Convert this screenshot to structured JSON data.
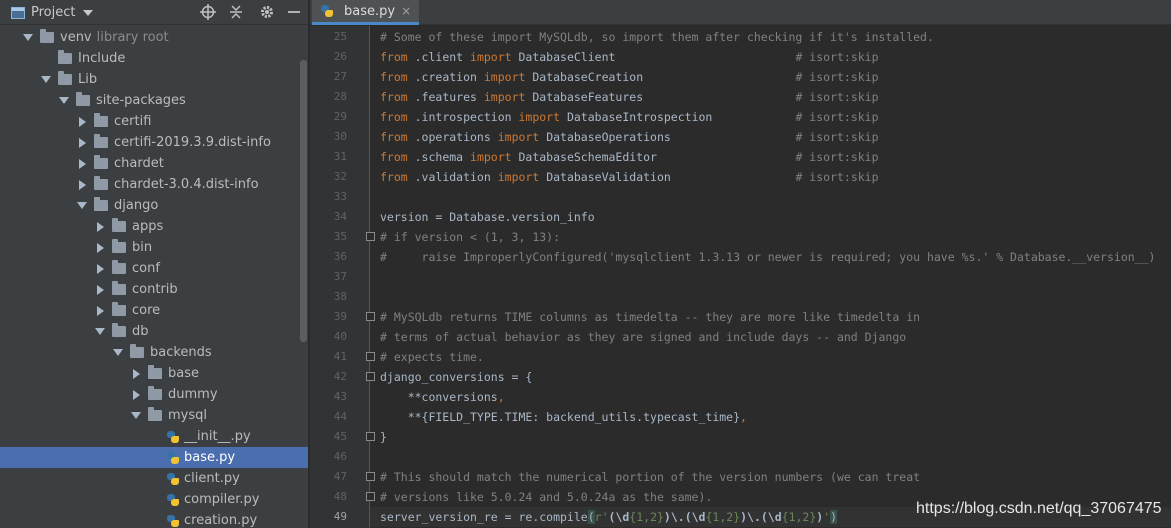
{
  "project_panel": {
    "title": "Project",
    "tree": [
      {
        "label": "venv",
        "sub": "library root",
        "indent": 0,
        "expand": "down",
        "icon": "folder-icon"
      },
      {
        "label": "Include",
        "indent": 1,
        "expand": "none",
        "icon": "folder-icon"
      },
      {
        "label": "Lib",
        "indent": 1,
        "expand": "down",
        "icon": "folder-icon"
      },
      {
        "label": "site-packages",
        "indent": 2,
        "expand": "down",
        "icon": "folder-icon"
      },
      {
        "label": "certifi",
        "indent": 3,
        "expand": "right",
        "icon": "folder-icon"
      },
      {
        "label": "certifi-2019.3.9.dist-info",
        "indent": 3,
        "expand": "right",
        "icon": "folder-icon"
      },
      {
        "label": "chardet",
        "indent": 3,
        "expand": "right",
        "icon": "folder-icon"
      },
      {
        "label": "chardet-3.0.4.dist-info",
        "indent": 3,
        "expand": "right",
        "icon": "folder-icon"
      },
      {
        "label": "django",
        "indent": 3,
        "expand": "down",
        "icon": "folder-icon"
      },
      {
        "label": "apps",
        "indent": 4,
        "expand": "right",
        "icon": "folder-icon"
      },
      {
        "label": "bin",
        "indent": 4,
        "expand": "right",
        "icon": "folder-icon"
      },
      {
        "label": "conf",
        "indent": 4,
        "expand": "right",
        "icon": "folder-icon"
      },
      {
        "label": "contrib",
        "indent": 4,
        "expand": "right",
        "icon": "folder-icon"
      },
      {
        "label": "core",
        "indent": 4,
        "expand": "right",
        "icon": "folder-icon"
      },
      {
        "label": "db",
        "indent": 4,
        "expand": "down",
        "icon": "folder-icon"
      },
      {
        "label": "backends",
        "indent": 5,
        "expand": "down",
        "icon": "folder-icon"
      },
      {
        "label": "base",
        "indent": 6,
        "expand": "right",
        "icon": "folder-icon"
      },
      {
        "label": "dummy",
        "indent": 6,
        "expand": "right",
        "icon": "folder-icon"
      },
      {
        "label": "mysql",
        "indent": 6,
        "expand": "down",
        "icon": "folder-icon"
      },
      {
        "label": "__init__.py",
        "indent": 7,
        "expand": "none",
        "icon": "python-file-icon"
      },
      {
        "label": "base.py",
        "indent": 7,
        "expand": "none",
        "icon": "python-file-icon",
        "selected": true
      },
      {
        "label": "client.py",
        "indent": 7,
        "expand": "none",
        "icon": "python-file-icon"
      },
      {
        "label": "compiler.py",
        "indent": 7,
        "expand": "none",
        "icon": "python-file-icon"
      },
      {
        "label": "creation.py",
        "indent": 7,
        "expand": "none",
        "icon": "python-file-icon"
      }
    ]
  },
  "editor": {
    "tab_label": "base.py",
    "tab_close": "×",
    "current_line": 49,
    "lines": [
      {
        "n": 25,
        "tokens": [
          [
            "com",
            "# Some of these import MySQLdb, so import them after checking if it's installed."
          ]
        ]
      },
      {
        "n": 26,
        "tokens": [
          [
            "kw",
            "from "
          ],
          [
            "plain",
            ".client "
          ],
          [
            "kw",
            "import "
          ],
          [
            "plain",
            "DatabaseClient                          "
          ],
          [
            "com",
            "# isort:skip"
          ]
        ]
      },
      {
        "n": 27,
        "tokens": [
          [
            "kw",
            "from "
          ],
          [
            "plain",
            ".creation "
          ],
          [
            "kw",
            "import "
          ],
          [
            "plain",
            "DatabaseCreation                      "
          ],
          [
            "com",
            "# isort:skip"
          ]
        ]
      },
      {
        "n": 28,
        "tokens": [
          [
            "kw",
            "from "
          ],
          [
            "plain",
            ".features "
          ],
          [
            "kw",
            "import "
          ],
          [
            "plain",
            "DatabaseFeatures                      "
          ],
          [
            "com",
            "# isort:skip"
          ]
        ]
      },
      {
        "n": 29,
        "tokens": [
          [
            "kw",
            "from "
          ],
          [
            "plain",
            ".introspection "
          ],
          [
            "kw",
            "import "
          ],
          [
            "plain",
            "DatabaseIntrospection            "
          ],
          [
            "com",
            "# isort:skip"
          ]
        ]
      },
      {
        "n": 30,
        "tokens": [
          [
            "kw",
            "from "
          ],
          [
            "plain",
            ".operations "
          ],
          [
            "kw",
            "import "
          ],
          [
            "plain",
            "DatabaseOperations                  "
          ],
          [
            "com",
            "# isort:skip"
          ]
        ]
      },
      {
        "n": 31,
        "tokens": [
          [
            "kw",
            "from "
          ],
          [
            "plain",
            ".schema "
          ],
          [
            "kw",
            "import "
          ],
          [
            "plain",
            "DatabaseSchemaEditor                    "
          ],
          [
            "com",
            "# isort:skip"
          ]
        ]
      },
      {
        "n": 32,
        "tokens": [
          [
            "kw",
            "from "
          ],
          [
            "plain",
            ".validation "
          ],
          [
            "kw",
            "import "
          ],
          [
            "plain",
            "DatabaseValidation                  "
          ],
          [
            "com",
            "# isort:skip"
          ]
        ]
      },
      {
        "n": 33,
        "tokens": []
      },
      {
        "n": 34,
        "tokens": [
          [
            "plain",
            "version = Database.version_info"
          ]
        ]
      },
      {
        "n": 35,
        "fold": true,
        "tokens": [
          [
            "com",
            "# if version < (1, 3, 13):"
          ]
        ]
      },
      {
        "n": 36,
        "tokens": [
          [
            "com",
            "#     raise ImproperlyConfigured('mysqlclient 1.3.13 or newer is required; you have %s.' % Database.__version__)"
          ]
        ]
      },
      {
        "n": 37,
        "tokens": []
      },
      {
        "n": 38,
        "tokens": []
      },
      {
        "n": 39,
        "fold": true,
        "tokens": [
          [
            "com",
            "# MySQLdb returns TIME columns as timedelta -- they are more like timedelta in"
          ]
        ]
      },
      {
        "n": 40,
        "tokens": [
          [
            "com",
            "# terms of actual behavior as they are signed and include days -- and Django"
          ]
        ]
      },
      {
        "n": 41,
        "fold": true,
        "tokens": [
          [
            "com",
            "# expects time."
          ]
        ]
      },
      {
        "n": 42,
        "fold": true,
        "tokens": [
          [
            "plain",
            "django_conversions = {"
          ]
        ]
      },
      {
        "n": 43,
        "tokens": [
          [
            "plain",
            "    **conversions"
          ],
          [
            "kw",
            ","
          ]
        ]
      },
      {
        "n": 44,
        "tokens": [
          [
            "plain",
            "    **{FIELD_TYPE.TIME: backend_utils.typecast_time}"
          ],
          [
            "kw",
            ","
          ]
        ]
      },
      {
        "n": 45,
        "fold": true,
        "tokens": [
          [
            "plain",
            "}"
          ]
        ]
      },
      {
        "n": 46,
        "tokens": []
      },
      {
        "n": 47,
        "fold": true,
        "tokens": [
          [
            "com",
            "# This should match the numerical portion of the version numbers (we can treat"
          ]
        ]
      },
      {
        "n": 48,
        "fold": true,
        "tokens": [
          [
            "com",
            "# versions like 5.0.24 and 5.0.24a as the same)."
          ]
        ]
      },
      {
        "n": 49,
        "tokens": [
          [
            "plain",
            "server_version_re = re.compile"
          ],
          [
            "paren",
            "("
          ],
          [
            "str",
            "r'"
          ],
          [
            "bold",
            "(\\d"
          ],
          [
            "str",
            "{1,2}"
          ],
          [
            "bold",
            ")\\.(\\d"
          ],
          [
            "str",
            "{1,2}"
          ],
          [
            "bold",
            ")\\.(\\d"
          ],
          [
            "str",
            "{1,2}"
          ],
          [
            "bold",
            ")"
          ],
          [
            "str",
            "'"
          ],
          [
            "paren",
            ")"
          ]
        ]
      }
    ]
  },
  "watermark": "https://blog.csdn.net/qq_37067475"
}
